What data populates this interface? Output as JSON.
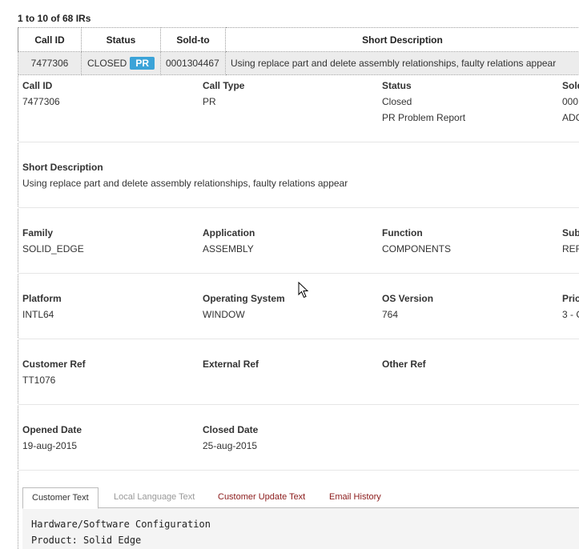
{
  "results_count": "1 to 10 of 68 IRs",
  "table": {
    "headers": [
      "Call ID",
      "Status",
      "Sold-to",
      "Short Description"
    ],
    "row": {
      "call_id": "7477306",
      "status": "CLOSED",
      "type_badge": "PR",
      "sold_to": "0001304467",
      "short_description": "Using replace part and delete assembly relationships, faulty relations appear"
    }
  },
  "detail": {
    "call_id_label": "Call ID",
    "call_id": "7477306",
    "call_type_label": "Call Type",
    "call_type": "PR",
    "status_label": "Status",
    "status": "Closed",
    "status_sub": "PR Problem Report",
    "sold_label": "Sold",
    "sold_value": "000",
    "sold_sub": "ADC",
    "short_desc_label": "Short Description",
    "short_desc": "Using replace part and delete assembly relationships, faulty relations appear",
    "family_label": "Family",
    "family": "SOLID_EDGE",
    "application_label": "Application",
    "application": "ASSEMBLY",
    "function_label": "Function",
    "function": "COMPONENTS",
    "sub_label": "Sub",
    "sub_value": "REF",
    "platform_label": "Platform",
    "platform": "INTL64",
    "os_label": "Operating System",
    "os": "WINDOW",
    "os_version_label": "OS Version",
    "os_version": "764",
    "priority_label": "Pric",
    "priority": "3 - C",
    "customer_ref_label": "Customer Ref",
    "customer_ref": "TT1076",
    "external_ref_label": "External Ref",
    "other_ref_label": "Other Ref",
    "opened_label": "Opened Date",
    "opened": "19-aug-2015",
    "closed_label": "Closed Date",
    "closed": "25-aug-2015"
  },
  "tabs": [
    "Customer Text",
    "Local Language Text",
    "Customer Update Text",
    "Email History"
  ],
  "customer_text": [
    "Hardware/Software Configuration",
    "Product: Solid Edge"
  ]
}
